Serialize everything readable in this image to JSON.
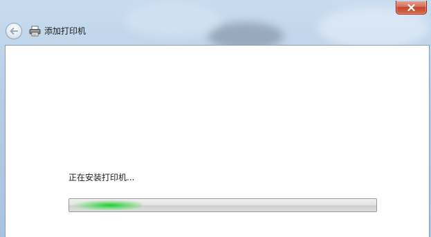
{
  "window": {
    "close_symbol": "×"
  },
  "navbar": {
    "back_icon": "back-arrow-icon",
    "title_icon": "printer-icon",
    "title": "添加打印机"
  },
  "main": {
    "status": "正在安装打印机...",
    "progress": {
      "state": "indeterminate",
      "color": "#22c93a"
    }
  },
  "colors": {
    "content_background": "#ffffff",
    "close_button": "#c74730"
  }
}
